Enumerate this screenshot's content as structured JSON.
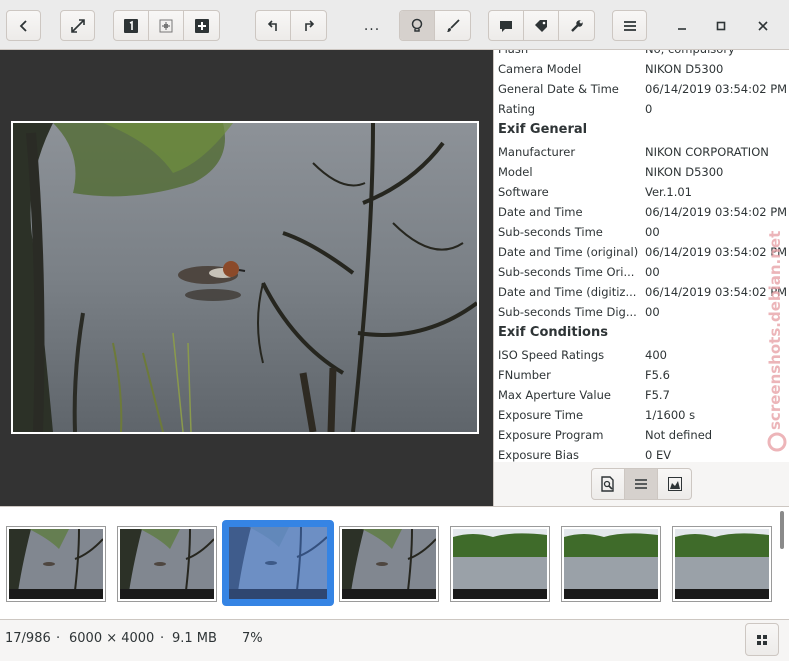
{
  "toolbar": {
    "more_label": "...",
    "icons": [
      "back-icon",
      "fullscreen-icon",
      "single-view-icon",
      "compare-icon",
      "add-icon",
      "rotate-left-icon",
      "rotate-right-icon",
      "more-icon",
      "lightbulb-icon",
      "brush-icon",
      "comment-icon",
      "tag-icon",
      "wrench-icon",
      "menu-icon",
      "minimize-icon",
      "maximize-icon",
      "close-icon"
    ]
  },
  "properties": {
    "top_rows": [
      {
        "k": "Flash",
        "v": "No, compulsory"
      },
      {
        "k": "Camera Model",
        "v": "NIKON D5300"
      },
      {
        "k": "General Date & Time",
        "v": "06/14/2019 03:54:02 PM"
      },
      {
        "k": "Rating",
        "v": "0"
      }
    ],
    "exif_general_title": "Exif General",
    "exif_general": [
      {
        "k": "Manufacturer",
        "v": "NIKON CORPORATION"
      },
      {
        "k": "Model",
        "v": "NIKON D5300"
      },
      {
        "k": "Software",
        "v": "Ver.1.01"
      },
      {
        "k": "Date and Time",
        "v": "06/14/2019 03:54:02 PM"
      },
      {
        "k": "Sub-seconds Time",
        "v": "00"
      },
      {
        "k": "Date and Time (original)",
        "v": "06/14/2019 03:54:02 PM"
      },
      {
        "k": "Sub-seconds Time Ori...",
        "v": "00"
      },
      {
        "k": "Date and Time (digitiz...",
        "v": "06/14/2019 03:54:02 PM"
      },
      {
        "k": "Sub-seconds Time Dig...",
        "v": "00"
      }
    ],
    "exif_conditions_title": "Exif Conditions",
    "exif_conditions": [
      {
        "k": "ISO Speed Ratings",
        "v": "400"
      },
      {
        "k": "FNumber",
        "v": "F5.6"
      },
      {
        "k": "Max Aperture Value",
        "v": "F5.7"
      },
      {
        "k": "Exposure Time",
        "v": "1/1600 s"
      },
      {
        "k": "Exposure Program",
        "v": "Not defined"
      },
      {
        "k": "Exposure Bias",
        "v": "0 EV"
      }
    ]
  },
  "watermark": "screenshots.debian.net",
  "filmstrip": {
    "thumbnails": [
      {
        "scene": "duck",
        "selected": false
      },
      {
        "scene": "duck",
        "selected": false
      },
      {
        "scene": "duck",
        "selected": true
      },
      {
        "scene": "duck",
        "selected": false
      },
      {
        "scene": "lake",
        "selected": false
      },
      {
        "scene": "lake",
        "selected": false
      },
      {
        "scene": "lake",
        "selected": false
      }
    ]
  },
  "status": {
    "position": "17/986",
    "sep1": "·",
    "dimensions": "6000 × 4000",
    "sep2": "·",
    "size": "9.1 MB",
    "zoom": "7%"
  }
}
